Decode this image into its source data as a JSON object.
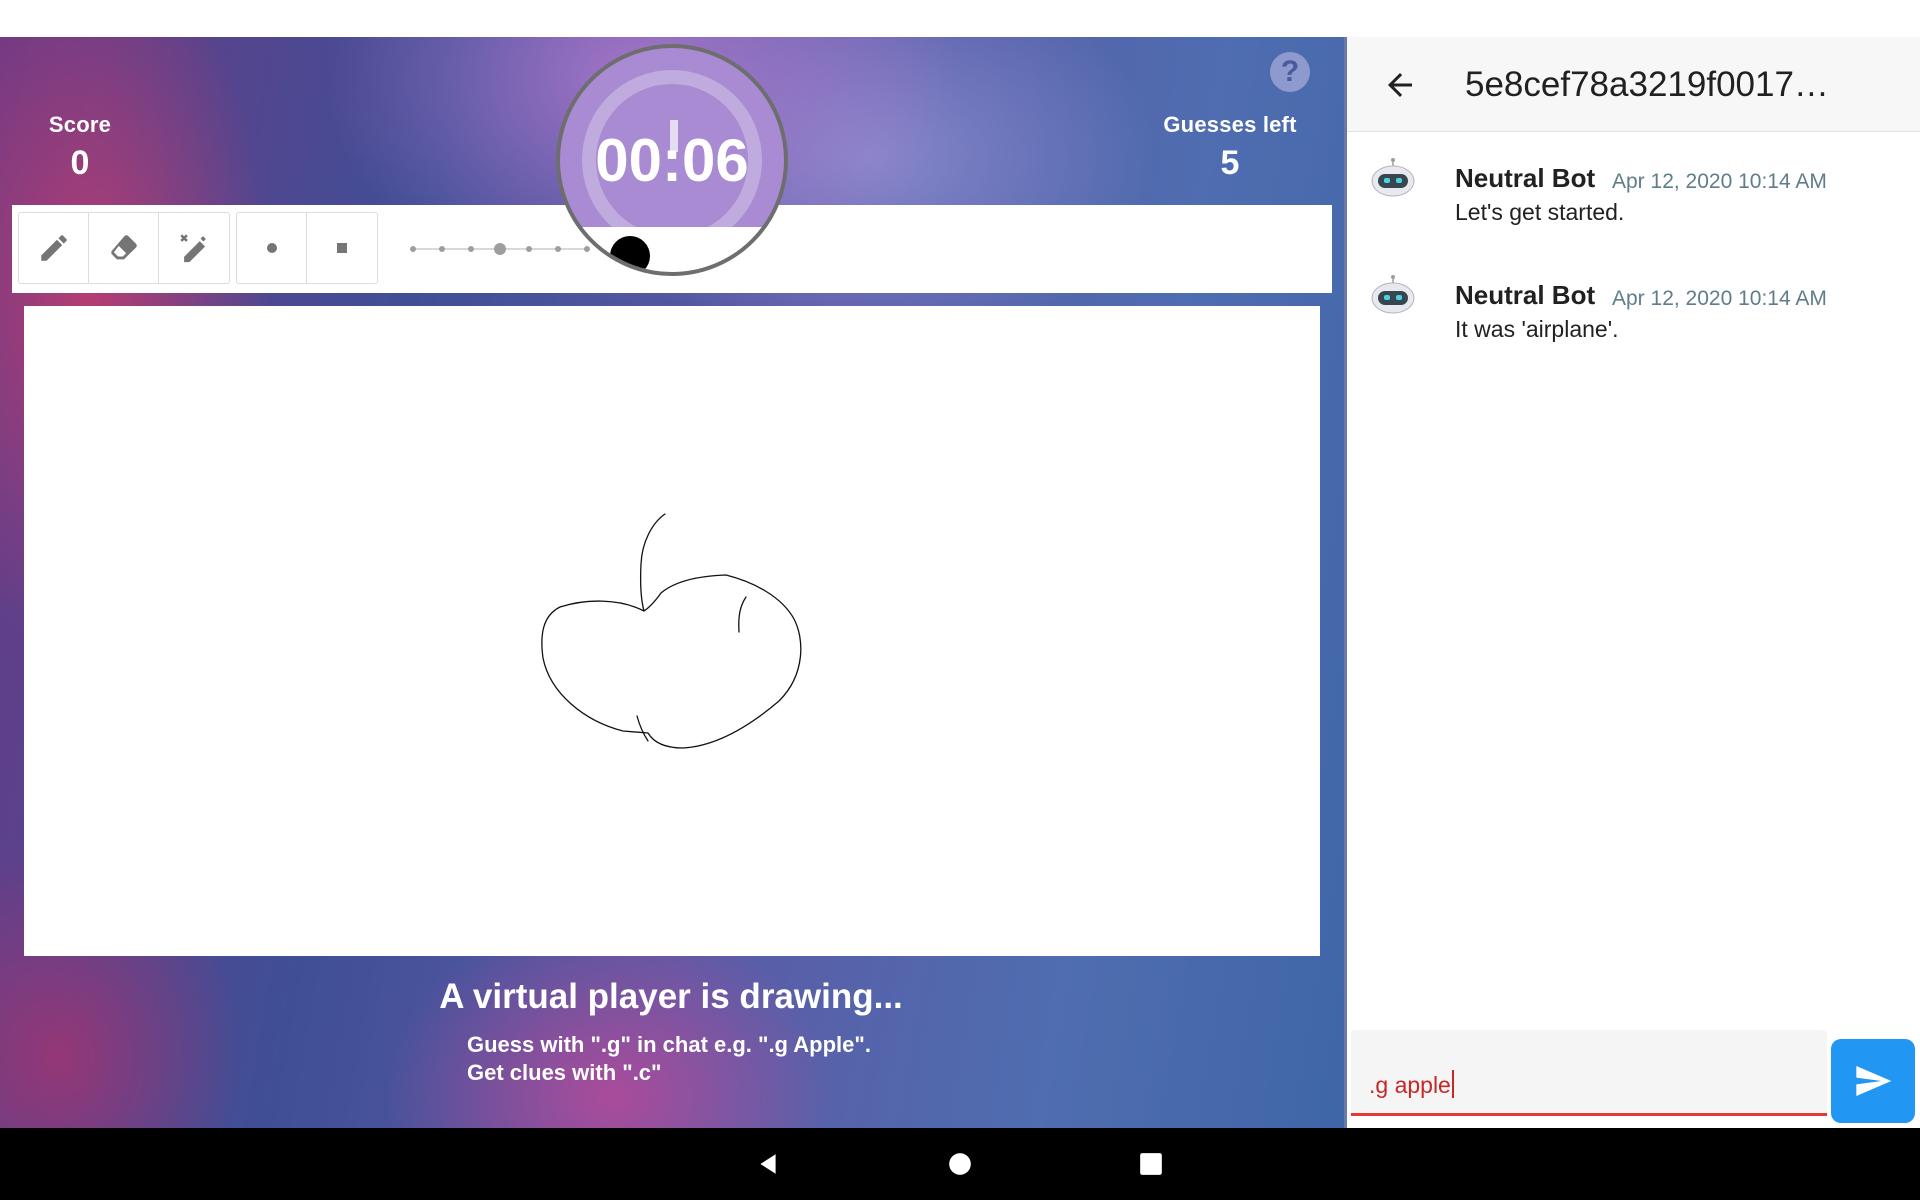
{
  "game": {
    "score_label": "Score",
    "score_value": "0",
    "guesses_label": "Guesses left",
    "guesses_value": "5",
    "timer": "00:06",
    "help_label": "?",
    "status_title": "A virtual player is drawing...",
    "hint_line_1": "Guess with \".g\" in chat e.g. \".g Apple\".",
    "hint_line_2": "Get clues with \".c\""
  },
  "toolbar": {
    "tools": [
      "pencil-icon",
      "eraser-icon",
      "magic-pencil-icon"
    ],
    "shapes": [
      "round-brush-icon",
      "square-brush-icon"
    ],
    "stroke_size_steps": 7,
    "stroke_size_selected": 4
  },
  "chat": {
    "title": "5e8cef78a3219f0017…",
    "messages": [
      {
        "author": "Neutral Bot",
        "time": "Apr 12, 2020 10:14 AM",
        "text": "Let's get started.",
        "avatar": "robot-icon"
      },
      {
        "author": "Neutral Bot",
        "time": "Apr 12, 2020 10:14 AM",
        "text": "It was 'airplane'.",
        "avatar": "robot-icon"
      }
    ],
    "input_value": ".g apple"
  },
  "colors": {
    "accent": "#2196f3",
    "input_underline": "#e53935",
    "timestamp": "#607d8b"
  }
}
